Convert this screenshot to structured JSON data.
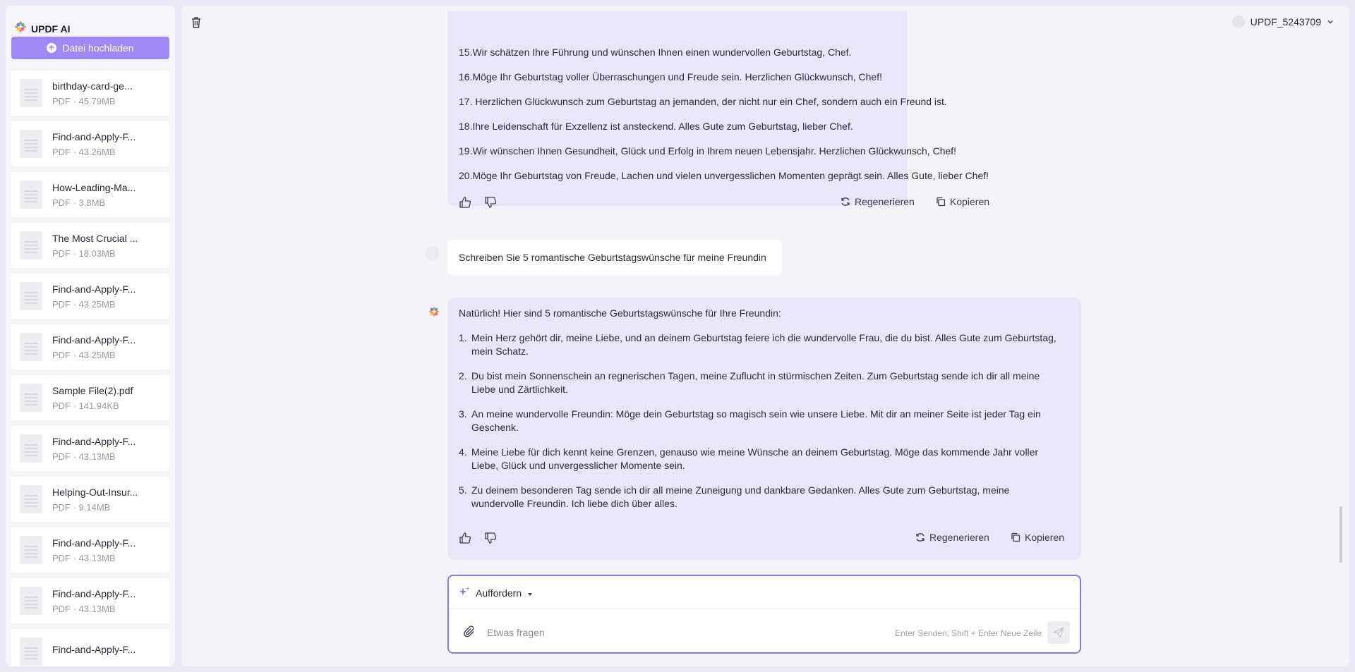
{
  "sidebar": {
    "brand": "UPDF AI",
    "upload_label": "Datei hochladen",
    "files": [
      {
        "name": "birthday-card-ge...",
        "meta": "PDF · 45.79MB"
      },
      {
        "name": "Find-and-Apply-F...",
        "meta": "PDF · 43.26MB"
      },
      {
        "name": "How-Leading-Ma...",
        "meta": "PDF · 3.8MB"
      },
      {
        "name": "The Most Crucial ...",
        "meta": "PDF · 18.03MB"
      },
      {
        "name": "Find-and-Apply-F...",
        "meta": "PDF · 43.25MB"
      },
      {
        "name": "Find-and-Apply-F...",
        "meta": "PDF · 43.25MB"
      },
      {
        "name": "Sample File(2).pdf",
        "meta": "PDF · 141.94KB"
      },
      {
        "name": "Find-and-Apply-F...",
        "meta": "PDF · 43.13MB"
      },
      {
        "name": "Helping-Out-Insur...",
        "meta": "PDF · 9.14MB"
      },
      {
        "name": "Find-and-Apply-F...",
        "meta": "PDF · 43.13MB"
      },
      {
        "name": "Find-and-Apply-F...",
        "meta": "PDF · 43.13MB"
      },
      {
        "name": "Find-and-Apply-F...",
        "meta": ""
      }
    ]
  },
  "header": {
    "username": "UPDF_5243709"
  },
  "chat": {
    "ai_message_1": {
      "lines": [
        "15.Wir schätzen Ihre Führung und wünschen Ihnen einen wundervollen Geburtstag, Chef.",
        "16.Möge Ihr Geburtstag voller Überraschungen und Freude sein. Herzlichen Glückwunsch, Chef!",
        "17. Herzlichen Glückwunsch zum Geburtstag an jemanden, der nicht nur ein Chef, sondern auch ein Freund ist.",
        "18.Ihre Leidenschaft für Exzellenz ist ansteckend. Alles Gute zum Geburtstag, lieber Chef.",
        "19.Wir wünschen Ihnen Gesundheit, Glück und Erfolg in Ihrem neuen Lebensjahr. Herzlichen Glückwunsch, Chef!",
        "20.Möge Ihr Geburtstag von Freude, Lachen und vielen unvergesslichen Momenten geprägt sein. Alles Gute, lieber Chef!"
      ],
      "regenerate_label": "Regenerieren",
      "copy_label": "Kopieren"
    },
    "user_message": "Schreiben Sie 5 romantische Geburtstagswünsche für meine Freundin",
    "ai_message_2": {
      "intro": "Natürlich! Hier sind 5 romantische Geburtstagswünsche für Ihre Freundin:",
      "items": [
        {
          "n": "1.",
          "line1": "Mein Herz gehört dir, meine Liebe, und an deinem Geburtstag feiere ich die wundervolle Frau, die du bist. Alles Gute zum Geburtstag,",
          "line2": "mein Schatz."
        },
        {
          "n": "2.",
          "line1": "Du bist mein Sonnenschein an regnerischen Tagen, meine Zuflucht in stürmischen Zeiten. Zum Geburtstag sende ich dir all meine",
          "line2": "Liebe und Zärtlichkeit."
        },
        {
          "n": "3.",
          "line1": "An meine wundervolle Freundin: Möge dein Geburtstag so magisch sein wie unsere Liebe. Mit dir an meiner Seite ist jeder Tag ein",
          "line2": "Geschenk."
        },
        {
          "n": "4.",
          "line1": "Meine Liebe für dich kennt keine Grenzen, genauso wie meine Wünsche an deinem Geburtstag. Möge das kommende Jahr voller",
          "line2": "Liebe, Glück und unvergesslicher Momente sein."
        },
        {
          "n": "5.",
          "line1": "Zu deinem besonderen Tag sende ich dir all meine Zuneigung und dankbare Gedanken. Alles Gute zum Geburtstag, meine",
          "line2": "wundervolle Freundin. Ich liebe dich über alles."
        }
      ],
      "regenerate_label": "Regenerieren",
      "copy_label": "Kopieren"
    }
  },
  "composer": {
    "prompt_mode": "Auffordern",
    "placeholder": "Etwas fragen",
    "hint": "Enter Senden; Shift + Enter Neue Zeile"
  },
  "colors": {
    "accent": "#a088f4",
    "input_border": "#8a77ee",
    "ai_bubble": "#e8e6f7"
  }
}
